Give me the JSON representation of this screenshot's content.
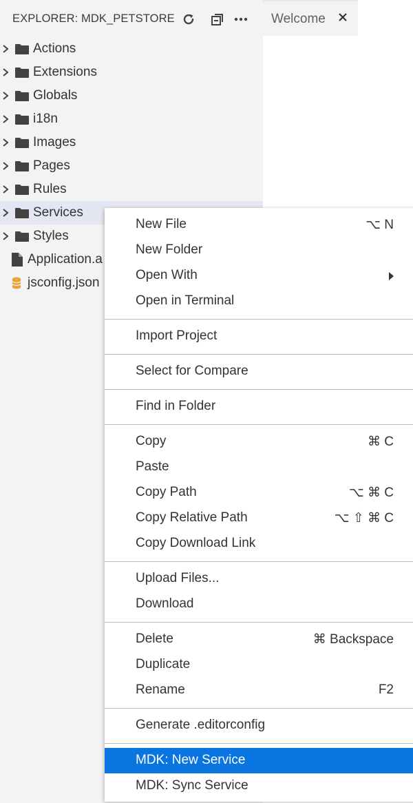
{
  "explorer": {
    "title": "EXPLORER: MDK_PETSTORE",
    "icons": [
      "refresh-icon",
      "collapse-all-icon",
      "more-icon"
    ],
    "folders": [
      {
        "label": "Actions"
      },
      {
        "label": "Extensions"
      },
      {
        "label": "Globals"
      },
      {
        "label": "i18n"
      },
      {
        "label": "Images"
      },
      {
        "label": "Pages"
      },
      {
        "label": "Rules"
      },
      {
        "label": "Services"
      },
      {
        "label": "Styles"
      }
    ],
    "files": [
      {
        "label": "Application.a",
        "icon": "file-icon"
      },
      {
        "label": "jsconfig.json",
        "icon": "json-icon"
      }
    ]
  },
  "editor": {
    "tab_label": "Welcome",
    "tab_close": "×"
  },
  "context_menu": {
    "groups": [
      [
        {
          "label": "New File",
          "shortcut": "⌥ N"
        },
        {
          "label": "New Folder",
          "shortcut": ""
        },
        {
          "label": "Open With",
          "shortcut": "",
          "submenu": true
        },
        {
          "label": "Open in Terminal",
          "shortcut": ""
        }
      ],
      [
        {
          "label": "Import Project",
          "shortcut": ""
        }
      ],
      [
        {
          "label": "Select for Compare",
          "shortcut": ""
        }
      ],
      [
        {
          "label": "Find in Folder",
          "shortcut": ""
        }
      ],
      [
        {
          "label": "Copy",
          "shortcut": "⌘ C"
        },
        {
          "label": "Paste",
          "shortcut": ""
        },
        {
          "label": "Copy Path",
          "shortcut": "⌥ ⌘ C"
        },
        {
          "label": "Copy Relative Path",
          "shortcut": "⌥ ⇧ ⌘ C"
        },
        {
          "label": "Copy Download Link",
          "shortcut": ""
        }
      ],
      [
        {
          "label": "Upload Files...",
          "shortcut": ""
        },
        {
          "label": "Download",
          "shortcut": ""
        }
      ],
      [
        {
          "label": "Delete",
          "shortcut": "⌘ Backspace"
        },
        {
          "label": "Duplicate",
          "shortcut": ""
        },
        {
          "label": "Rename",
          "shortcut": "F2"
        }
      ],
      [
        {
          "label": "Generate .editorconfig",
          "shortcut": ""
        }
      ],
      [
        {
          "label": "MDK: New Service",
          "shortcut": "",
          "highlighted": true
        },
        {
          "label": "MDK: Sync Service",
          "shortcut": ""
        }
      ]
    ]
  },
  "colors": {
    "sidebar_bg": "#f3f3f3",
    "selected_row": "#e4e6f1",
    "menu_highlight": "#0a74e0",
    "json_icon": "#e8a33d"
  }
}
